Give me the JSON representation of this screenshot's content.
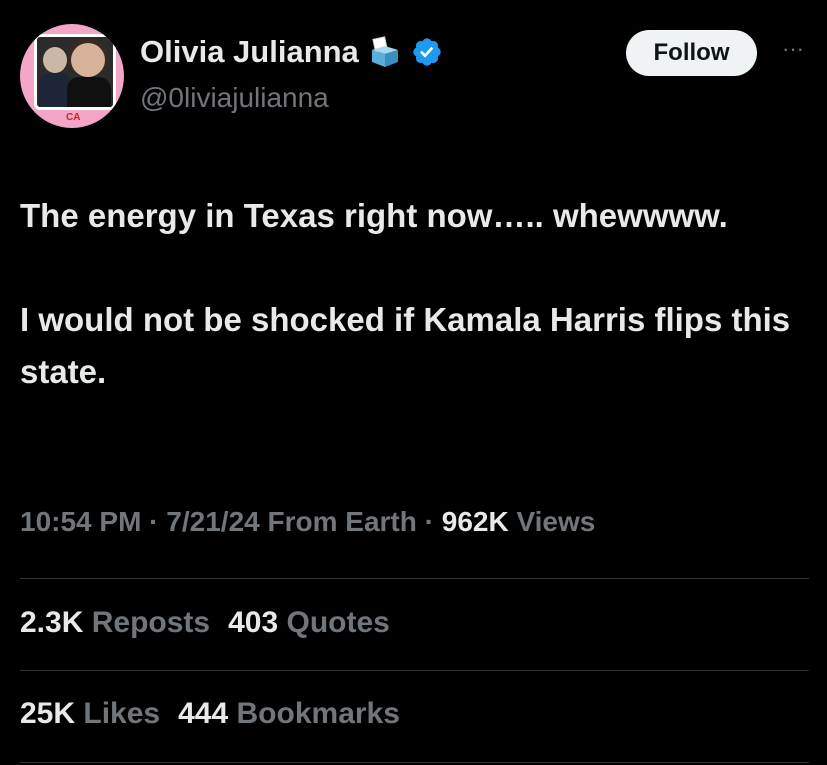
{
  "author": {
    "display_name": "Olivia Julianna",
    "handle": "@0liviajulianna",
    "avatar_text": "CA",
    "badges": [
      "ballot-box-icon",
      "verified-icon"
    ]
  },
  "actions": {
    "follow_label": "Follow",
    "more_label": "···"
  },
  "tweet": {
    "paragraphs": [
      "The energy in Texas right now….. whewwww.",
      "I would not be shocked if Kamala Harris flips this state."
    ]
  },
  "meta": {
    "time": "10:54 PM",
    "sep1": " · ",
    "date": "7/21/24",
    "source": " From Earth",
    "sep2": " · ",
    "views_count": "962K",
    "views_label": " Views"
  },
  "stats": {
    "reposts_count": "2.3K",
    "reposts_label": "Reposts",
    "quotes_count": "403",
    "quotes_label": "Quotes",
    "likes_count": "25K",
    "likes_label": "Likes",
    "bookmarks_count": "444",
    "bookmarks_label": "Bookmarks"
  },
  "colors": {
    "background": "#000000",
    "text_primary": "#e7e9ea",
    "text_secondary": "#71767b",
    "verified_blue": "#1d9bf0",
    "divider": "#2f3336",
    "follow_bg": "#eff3f4"
  }
}
